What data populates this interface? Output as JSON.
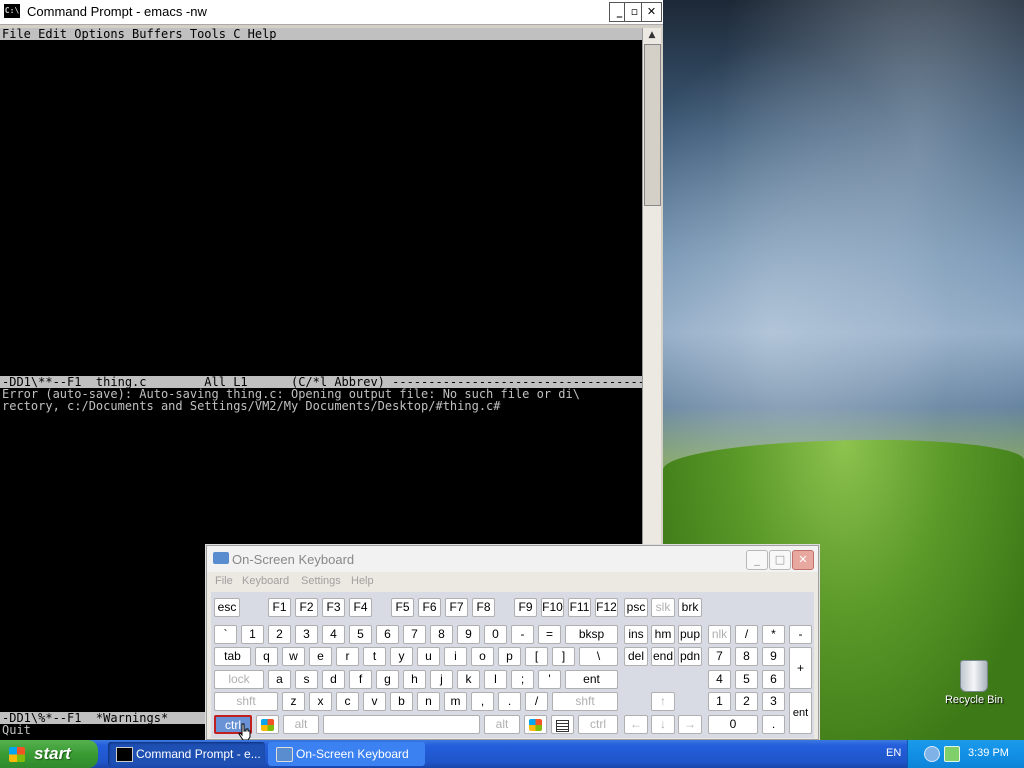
{
  "cmd_window": {
    "icon_text": "C:\\",
    "title": "Command Prompt - emacs -nw",
    "minimize": "_",
    "maximize": "▫",
    "close": "✕"
  },
  "emacs": {
    "menubar": "File Edit Options Buffers Tools C Help",
    "modeline_top": "-DD1\\**--F1  thing.c        All L1      (C/*l Abbrev) -------------------------------------",
    "error_line1": "Error (auto-save): Auto-saving thing.c: Opening output file: No such file or di\\",
    "error_line2": "rectory, c:/Documents and Settings/VM2/My Documents/Desktop/#thing.c#",
    "modeline_bottom": "-DD1\\%*--F1  *Warnings*",
    "minibuffer": "Quit"
  },
  "osk": {
    "title": "On-Screen Keyboard",
    "menu": [
      "File",
      "Keyboard",
      "Settings",
      "Help"
    ],
    "row1": [
      "esc",
      "F1",
      "F2",
      "F3",
      "F4",
      "F5",
      "F6",
      "F7",
      "F8",
      "F9",
      "F10",
      "F11",
      "F12",
      "psc",
      "slk",
      "brk"
    ],
    "row2": [
      "`",
      "1",
      "2",
      "3",
      "4",
      "5",
      "6",
      "7",
      "8",
      "9",
      "0",
      "-",
      "=",
      "bksp",
      "ins",
      "hm",
      "pup",
      "nlk",
      "/",
      "*",
      "-"
    ],
    "row3": [
      "tab",
      "q",
      "w",
      "e",
      "r",
      "t",
      "y",
      "u",
      "i",
      "o",
      "p",
      "[",
      "]",
      "\\",
      "del",
      "end",
      "pdn",
      "7",
      "8",
      "9",
      "+"
    ],
    "row4": [
      "lock",
      "a",
      "s",
      "d",
      "f",
      "g",
      "h",
      "j",
      "k",
      "l",
      ";",
      "'",
      "ent",
      "4",
      "5",
      "6"
    ],
    "row5": [
      "shft",
      "z",
      "x",
      "c",
      "v",
      "b",
      "n",
      "m",
      ",",
      ".",
      "/",
      "shft",
      "↑",
      "1",
      "2",
      "3",
      "ent"
    ],
    "row6": [
      "ctrl",
      "alt",
      "alt",
      "ctrl",
      "←",
      "↓",
      "→",
      "0",
      "."
    ]
  },
  "desktop": {
    "recycle_bin": "Recycle Bin"
  },
  "taskbar": {
    "start": "start",
    "tasks": [
      "Command Prompt - e...",
      "On-Screen Keyboard"
    ],
    "language": "EN",
    "clock": "3:39 PM"
  },
  "colors": {
    "terminal_bg": "#000000",
    "terminal_fg": "#c0c0c0",
    "taskbar_blue": "#245edb",
    "start_green": "#3a9b33",
    "selected_key": "#6a93d6"
  }
}
